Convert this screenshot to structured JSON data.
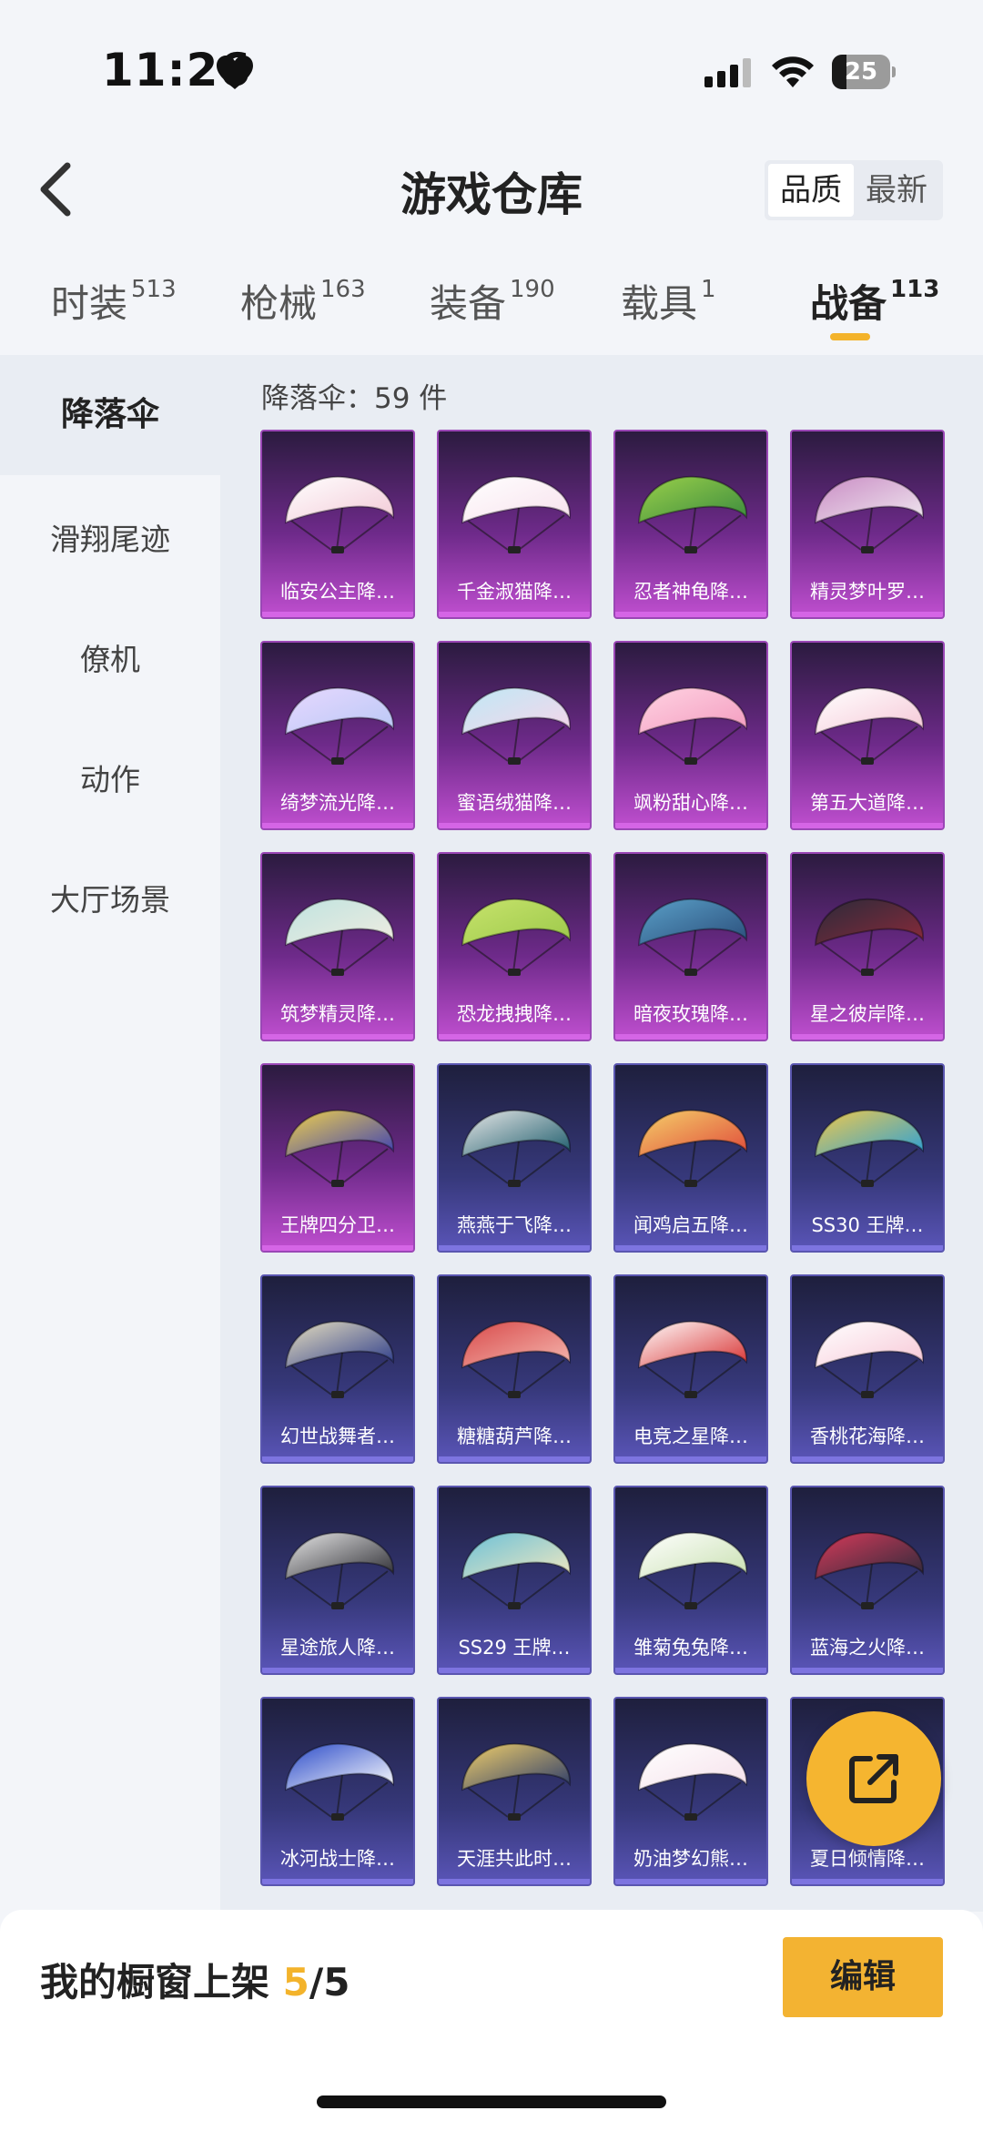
{
  "status_bar": {
    "time": "11:26",
    "battery": "25",
    "battery_level": 0.25
  },
  "header": {
    "title": "游戏仓库",
    "sort_options": [
      "品质",
      "最新"
    ]
  },
  "tabs": [
    {
      "label": "时装",
      "count": "513"
    },
    {
      "label": "枪械",
      "count": "163"
    },
    {
      "label": "装备",
      "count": "190"
    },
    {
      "label": "载具",
      "count": "1"
    },
    {
      "label": "战备",
      "count": "113"
    }
  ],
  "sidebar": {
    "items": [
      {
        "label": "降落伞"
      },
      {
        "label": "滑翔尾迹"
      },
      {
        "label": "僚机"
      },
      {
        "label": "动作"
      },
      {
        "label": "大厅场景"
      }
    ]
  },
  "content": {
    "count_label": "降落伞：59 件"
  },
  "items": [
    {
      "name": "临安公主降…",
      "tier": "purple",
      "colors": [
        "#f2c9d6",
        "#ffffff"
      ]
    },
    {
      "name": "千金淑猫降…",
      "tier": "purple",
      "colors": [
        "#f7e1ec",
        "#ffffff"
      ]
    },
    {
      "name": "忍者神龟降…",
      "tier": "purple",
      "colors": [
        "#3a8a3e",
        "#9ad04a"
      ]
    },
    {
      "name": "精灵梦叶罗…",
      "tier": "purple",
      "colors": [
        "#f0e8f0",
        "#c98cc4"
      ]
    },
    {
      "name": "绮梦流光降…",
      "tier": "purple",
      "colors": [
        "#b9c8f5",
        "#e7d8ff"
      ]
    },
    {
      "name": "蜜语绒猫降…",
      "tier": "purple",
      "colors": [
        "#f6d6ea",
        "#bfe8f5"
      ]
    },
    {
      "name": "飒粉甜心降…",
      "tier": "purple",
      "colors": [
        "#f39bbf",
        "#ffd3e2"
      ]
    },
    {
      "name": "第五大道降…",
      "tier": "purple",
      "colors": [
        "#f5c7d6",
        "#ffffff"
      ]
    },
    {
      "name": "筑梦精灵降…",
      "tier": "purple",
      "colors": [
        "#f0ece0",
        "#bfe3e0"
      ]
    },
    {
      "name": "恐龙拽拽降…",
      "tier": "purple",
      "colors": [
        "#9cc84a",
        "#c7e36c"
      ]
    },
    {
      "name": "暗夜玫瑰降…",
      "tier": "purple",
      "colors": [
        "#2a4d7a",
        "#5aa0c8"
      ]
    },
    {
      "name": "星之彼岸降…",
      "tier": "purple",
      "colors": [
        "#8a2a3a",
        "#2a2a3a"
      ]
    },
    {
      "name": "王牌四分卫…",
      "tier": "purple",
      "colors": [
        "#3b3fb5",
        "#f2d24a"
      ]
    },
    {
      "name": "燕燕于飞降…",
      "tier": "blue",
      "colors": [
        "#1a5a6a",
        "#e8e8e8"
      ]
    },
    {
      "name": "闻鸡启五降…",
      "tier": "blue",
      "colors": [
        "#e04a3a",
        "#f5d06a"
      ]
    },
    {
      "name": "SS30 王牌…",
      "tier": "blue",
      "colors": [
        "#2aa0d8",
        "#f2c94a"
      ]
    },
    {
      "name": "幻世战舞者…",
      "tier": "blue",
      "colors": [
        "#2a3a8a",
        "#e8e0c0"
      ]
    },
    {
      "name": "糖糖葫芦降…",
      "tier": "blue",
      "colors": [
        "#f5b8b0",
        "#d84a4a"
      ]
    },
    {
      "name": "电竞之星降…",
      "tier": "blue",
      "colors": [
        "#d83030",
        "#ffffff"
      ]
    },
    {
      "name": "香桃花海降…",
      "tier": "blue",
      "colors": [
        "#f7c7d6",
        "#ffffff"
      ]
    },
    {
      "name": "星途旅人降…",
      "tier": "blue",
      "colors": [
        "#2a2a30",
        "#e8e8e8"
      ]
    },
    {
      "name": "SS29 王牌…",
      "tier": "blue",
      "colors": [
        "#f2e8c0",
        "#6ac0d8"
      ]
    },
    {
      "name": "雏菊兔兔降…",
      "tier": "blue",
      "colors": [
        "#c8e0b0",
        "#ffffff"
      ]
    },
    {
      "name": "蓝海之火降…",
      "tier": "blue",
      "colors": [
        "#2a2a3a",
        "#d83a5a"
      ]
    },
    {
      "name": "冰河战士降…",
      "tier": "blue",
      "colors": [
        "#ffffff",
        "#2a4ac8"
      ]
    },
    {
      "name": "天涯共此时…",
      "tier": "blue",
      "colors": [
        "#2a3a6a",
        "#f2d06a"
      ]
    },
    {
      "name": "奶油梦幻熊…",
      "tier": "blue",
      "colors": [
        "#f5e0ea",
        "#ffffff"
      ]
    },
    {
      "name": "夏日倾情降…",
      "tier": "blue",
      "colors": [
        "#3a4a8a",
        "#f5b530"
      ]
    }
  ],
  "bottom": {
    "showcase_prefix": "我的橱窗上架 ",
    "showcase_count": "5",
    "showcase_total": "/5",
    "edit_label": "编辑"
  },
  "accent_color": "#f3b32b"
}
